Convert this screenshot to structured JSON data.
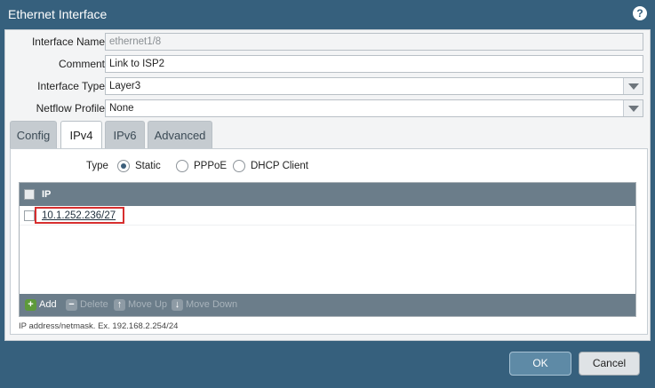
{
  "window": {
    "title": "Ethernet Interface",
    "help_icon": "help-icon"
  },
  "form": {
    "interface_name_label": "Interface Name",
    "interface_name_value": "ethernet1/8",
    "comment_label": "Comment",
    "comment_value": "Link to ISP2",
    "interface_type_label": "Interface Type",
    "interface_type_value": "Layer3",
    "netflow_profile_label": "Netflow Profile",
    "netflow_profile_value": "None"
  },
  "tabs": [
    {
      "label": "Config",
      "active": false
    },
    {
      "label": "IPv4",
      "active": true
    },
    {
      "label": "IPv6",
      "active": false
    },
    {
      "label": "Advanced",
      "active": false
    }
  ],
  "ipv4": {
    "type_label": "Type",
    "options": [
      {
        "label": "Static",
        "checked": true
      },
      {
        "label": "PPPoE",
        "checked": false
      },
      {
        "label": "DHCP Client",
        "checked": false
      }
    ],
    "grid": {
      "column_ip": "IP",
      "rows": [
        "10.1.252.236/27"
      ]
    },
    "toolbar": {
      "add": "Add",
      "delete": "Delete",
      "move_up": "Move Up",
      "move_down": "Move Down"
    },
    "hint": "IP address/netmask. Ex. 192.168.2.254/24"
  },
  "buttons": {
    "ok": "OK",
    "cancel": "Cancel"
  },
  "colors": {
    "titlebar": "#36607d",
    "highlight": "#d72f2f",
    "grid_header": "#6b7d8a"
  }
}
